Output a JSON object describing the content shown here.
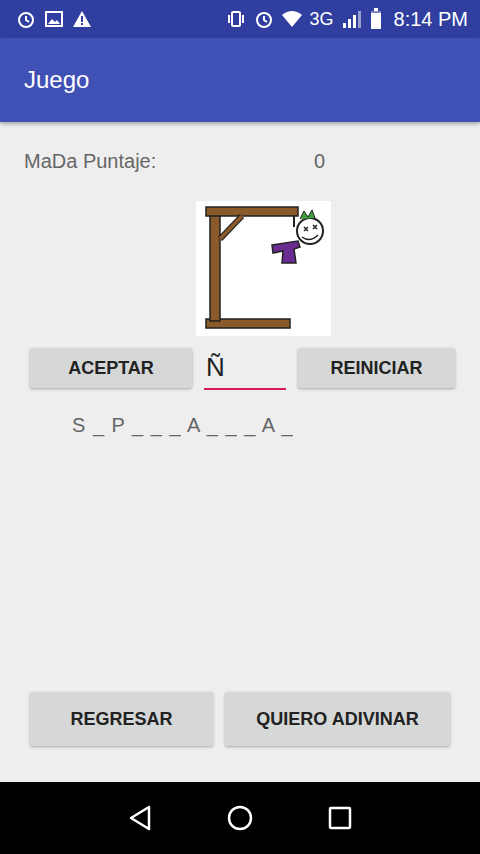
{
  "status_bar": {
    "time": "8:14 PM",
    "network": "3G",
    "battery_level": 0.85
  },
  "app_bar": {
    "title": "Juego"
  },
  "score": {
    "label": "MaDa Puntaje:",
    "value": "0"
  },
  "guess_input": {
    "value": "Ñ"
  },
  "buttons": {
    "accept": "ACEPTAR",
    "restart": "REINICIAR",
    "back": "REGRESAR",
    "guess": "QUIERO ADIVINAR"
  },
  "word": "S _ P _ _ _ A _ _ _ A _"
}
